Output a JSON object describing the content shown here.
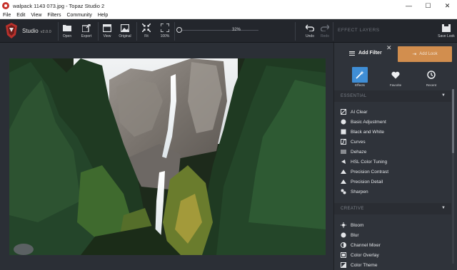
{
  "window": {
    "title": "walpack 1143 073.jpg - Topaz Studio 2",
    "controls": {
      "minimize": "—",
      "maximize": "☐",
      "close": "✕"
    }
  },
  "menu": [
    "File",
    "Edit",
    "View",
    "Filters",
    "Community",
    "Help"
  ],
  "brand": {
    "name": "Studio",
    "version": "v2.0.0"
  },
  "toolbar": {
    "open": "Open",
    "export": "Export",
    "view": "View",
    "original": "Original",
    "fit": "Fit",
    "zoom100": "100%",
    "zoom_value": "32%",
    "zoom_level": 0.32,
    "undo": "Undo",
    "redo": "Redo",
    "effect_layers": "EFFECT LAYERS",
    "save_look": "Save Look"
  },
  "panel": {
    "add_filter": "Add Filter",
    "add_look": "Add Look",
    "categories": [
      "Effects",
      "Favorite",
      "Recent"
    ],
    "sections": [
      {
        "title": "ESSENTIAL",
        "items": [
          {
            "label": "AI Clear",
            "icon": "ai-clear-icon"
          },
          {
            "label": "Basic Adjustment",
            "icon": "circle-icon"
          },
          {
            "label": "Black and White",
            "icon": "square-icon"
          },
          {
            "label": "Curves",
            "icon": "curves-icon"
          },
          {
            "label": "Dehaze",
            "icon": "dehaze-icon"
          },
          {
            "label": "HSL Color Tuning",
            "icon": "hsl-icon"
          },
          {
            "label": "Precision Contrast",
            "icon": "contrast-icon"
          },
          {
            "label": "Precision Detail",
            "icon": "detail-icon"
          },
          {
            "label": "Sharpen",
            "icon": "sharpen-icon"
          }
        ]
      },
      {
        "title": "CREATIVE",
        "items": [
          {
            "label": "Bloom",
            "icon": "bloom-icon"
          },
          {
            "label": "Blur",
            "icon": "blur-icon"
          },
          {
            "label": "Channel Mixer",
            "icon": "channel-mixer-icon"
          },
          {
            "label": "Color Overlay",
            "icon": "color-overlay-icon"
          },
          {
            "label": "Color Theme",
            "icon": "color-theme-icon"
          }
        ]
      }
    ]
  },
  "colors": {
    "accent": "#3f8ed6",
    "add_look": "#d28e4e",
    "panel": "#2f333a",
    "toolbar": "#23262c"
  }
}
